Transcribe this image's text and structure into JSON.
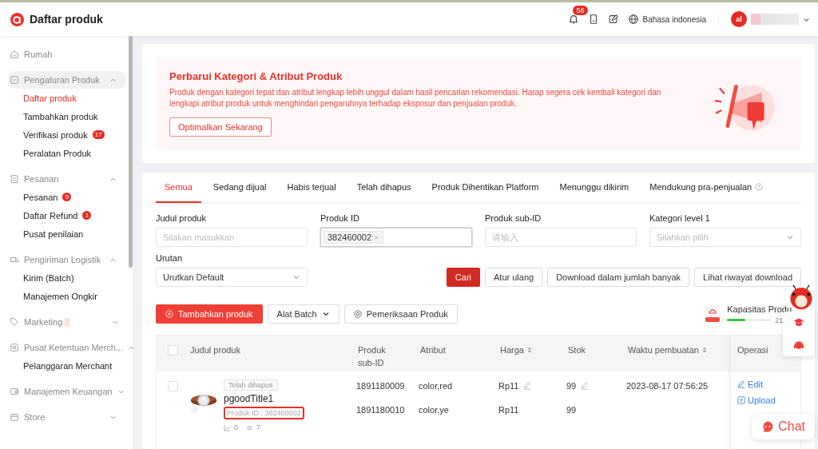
{
  "app": {
    "title": "Daftar produk"
  },
  "header": {
    "notification_count": "56",
    "language": "Bahasa indonesia",
    "avatar_initials": "al"
  },
  "sidebar": {
    "items": [
      {
        "kind": "link",
        "label": "Rumah"
      },
      {
        "kind": "group",
        "label": "Pengaturan Produk",
        "active": true,
        "expanded": true,
        "dot": false,
        "children": [
          {
            "label": "Daftar produk",
            "selected": true
          },
          {
            "label": "Tambahkan produk",
            "selected": false
          },
          {
            "label": "Verifikasi produk",
            "selected": false,
            "badge": "17"
          },
          {
            "label": "Peralatan Produk",
            "selected": false
          }
        ]
      },
      {
        "kind": "group",
        "label": "Pesanan",
        "active": false,
        "expanded": true,
        "dot": false,
        "children": [
          {
            "label": "Pesanan",
            "selected": false,
            "badge": "5"
          },
          {
            "label": "Daftar Refund",
            "selected": false,
            "badge": "1"
          },
          {
            "label": "Pusat penilaian",
            "selected": false
          }
        ]
      },
      {
        "kind": "group",
        "label": "Pengiriman Logistik",
        "active": false,
        "expanded": true,
        "dot": false,
        "children": [
          {
            "label": "Kirim (Batch)",
            "selected": false
          },
          {
            "label": "Manajemen Ongkir",
            "selected": false
          }
        ]
      },
      {
        "kind": "group",
        "label": "Marketing",
        "active": false,
        "expanded": false,
        "dot": true
      },
      {
        "kind": "group",
        "label": "Pusat Ketentuan Merch...",
        "active": false,
        "expanded": true,
        "dot": false,
        "children": [
          {
            "label": "Pelanggaran Merchant",
            "selected": false
          }
        ]
      },
      {
        "kind": "group",
        "label": "Manajemen Keuangan",
        "active": false,
        "expanded": false,
        "dot": false
      },
      {
        "kind": "group",
        "label": "Store",
        "active": false,
        "expanded": false,
        "dot": false
      }
    ]
  },
  "banner": {
    "title": "Perbarui Kategori & Atribut Produk",
    "text": "Produk dengan kategori tepat dan atribut lengkap lebih unggul dalam hasil pencarian rekomendasi. Harap segera cek kembali kategori dan lengkapi atribut produk untuk menghindari pengaruhnya terhadap eksposur dan penjualan produk.",
    "button": "Optimalkan Sekarang"
  },
  "tabs": [
    {
      "label": "Semua",
      "selected": true,
      "help": false
    },
    {
      "label": "Sedang dijual",
      "selected": false,
      "help": false
    },
    {
      "label": "Habis terjual",
      "selected": false,
      "help": false
    },
    {
      "label": "Telah dihapus",
      "selected": false,
      "help": false
    },
    {
      "label": "Produk Dihentikan Platform",
      "selected": false,
      "help": false
    },
    {
      "label": "Menunggu dikirim",
      "selected": false,
      "help": false
    },
    {
      "label": "Mendukung pra-penjualan",
      "selected": false,
      "help": true
    }
  ],
  "filters": [
    {
      "kind": "text",
      "label": "Judul produk",
      "placeholder": "Silakan masukkan",
      "focused": false
    },
    {
      "kind": "tags",
      "label": "Produk ID",
      "tags": [
        "382460002"
      ],
      "focused": true
    },
    {
      "kind": "text",
      "label": "Produk sub-ID",
      "placeholder": "请输入",
      "focused": false
    },
    {
      "kind": "select",
      "label": "Kategori level 1",
      "placeholder": "Silahkan pilih",
      "focused": false
    },
    {
      "kind": "select",
      "label": "Urutan",
      "value": "Urutkan Default",
      "focused": false
    }
  ],
  "actions": [
    {
      "label": "Cari",
      "primary": true
    },
    {
      "label": "Atur ulang",
      "primary": false
    },
    {
      "label": "Download dalam jumlah banyak",
      "primary": false
    },
    {
      "label": "Lihat riwayat download",
      "primary": false
    }
  ],
  "toolbar": [
    {
      "kind": "add",
      "label": "Tambahkan produk"
    },
    {
      "kind": "dropdown",
      "label": "Alat Batch"
    },
    {
      "kind": "check",
      "label": "Pemeriksaan Produk"
    }
  ],
  "capacity": {
    "label": "Kapasitas Produ",
    "count": "21",
    "level": 0.4
  },
  "table": {
    "all_checked": false,
    "columns": [
      {
        "label": "Judul produk",
        "sortable": false
      },
      {
        "label": "Produk sub-ID",
        "sortable": false
      },
      {
        "label": "Atribut",
        "sortable": false
      },
      {
        "label": "Harga",
        "sortable": true
      },
      {
        "label": "Stok",
        "sortable": false
      },
      {
        "label": "Waktu pembuatan",
        "sortable": true
      },
      {
        "label": "Operasi",
        "sortable": false
      }
    ],
    "rows": [
      {
        "checked": false,
        "status": "Telah dihapus",
        "title": "pgoodTitle1",
        "product_id": "Produk ID : 382460002",
        "highlighted": true,
        "sales": "0",
        "views": "7",
        "created": "2023-08-17 07:56:25",
        "variants": [
          {
            "sub_id": "1891180009",
            "attribute": "color,red",
            "price": "Rp11",
            "stock": "99",
            "editable": true
          },
          {
            "sub_id": "1891180010",
            "attribute": "color,ye",
            "price": "Rp11",
            "stock": "99",
            "editable": false
          }
        ],
        "operations": [
          {
            "kind": "edit",
            "label": "Edit"
          },
          {
            "kind": "upload",
            "label": "Upload"
          }
        ]
      }
    ]
  },
  "chat": {
    "label": "Chat"
  }
}
